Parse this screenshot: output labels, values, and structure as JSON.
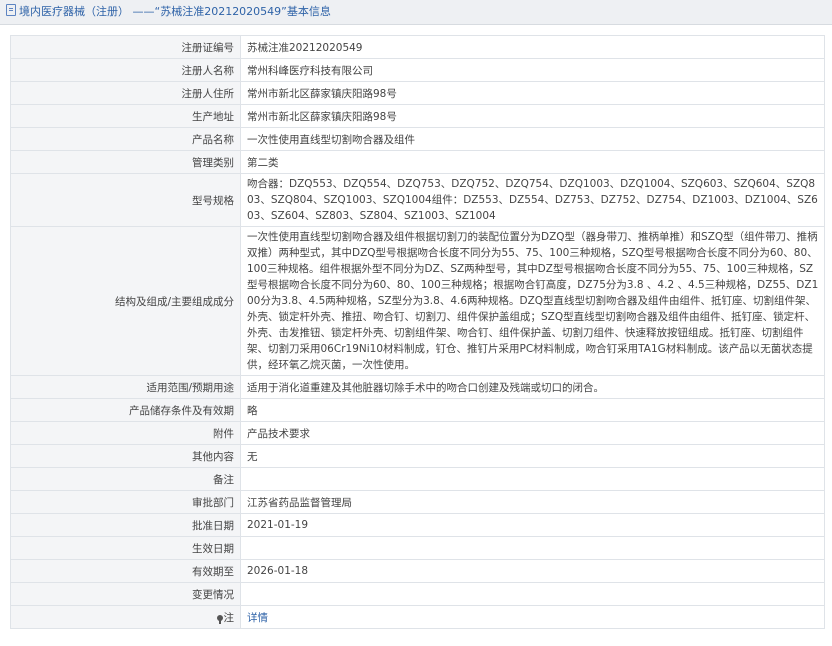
{
  "header": {
    "title": "境内医疗器械（注册） ——“苏械注准20212020549”基本信息"
  },
  "rows": [
    {
      "label": "注册证编号",
      "value": "苏械注准20212020549"
    },
    {
      "label": "注册人名称",
      "value": "常州科峰医疗科技有限公司"
    },
    {
      "label": "注册人住所",
      "value": "常州市新北区薛家镇庆阳路98号"
    },
    {
      "label": "生产地址",
      "value": "常州市新北区薛家镇庆阳路98号"
    },
    {
      "label": "产品名称",
      "value": "一次性使用直线型切割吻合器及组件"
    },
    {
      "label": "管理类别",
      "value": "第二类"
    },
    {
      "label": "型号规格",
      "value": "吻合器：DZQ553、DZQ554、DZQ753、DZQ752、DZQ754、DZQ1003、DZQ1004、SZQ603、SZQ604、SZQ803、SZQ804、SZQ1003、SZQ1004组件：DZ553、DZ554、DZ753、DZ752、DZ754、DZ1003、DZ1004、SZ603、SZ604、SZ803、SZ804、SZ1003、SZ1004"
    },
    {
      "label": "结构及组成/主要组成成分",
      "value": "一次性使用直线型切割吻合器及组件根据切割刀的装配位置分为DZQ型（器身带刀、推柄单推）和SZQ型（组件带刀、推柄双推）两种型式，其中DZQ型号根据吻合长度不同分为55、75、100三种规格，SZQ型号根据吻合长度不同分为60、80、100三种规格。组件根据外型不同分为DZ、SZ两种型号，其中DZ型号根据吻合长度不同分为55、75、100三种规格，SZ型号根据吻合长度不同分为60、80、100三种规格；根据吻合钉高度，DZ75分为3.8 、4.2 、4.5三种规格，DZ55、DZ100分为3.8、4.5两种规格，SZ型分为3.8、4.6两种规格。DZQ型直线型切割吻合器及组件由组件、抵钉座、切割组件架、外壳、锁定杆外壳、推扭、吻合钉、切割刀、组件保护盖组成；SZQ型直线型切割吻合器及组件由组件、抵钉座、锁定杆、外壳、击发推钮、锁定杆外壳、切割组件架、吻合钉、组件保护盖、切割刀组件、快速释放按钮组成。抵钉座、切割组件架、切割刀采用06Cr19Ni10材料制成，钉仓、推钉片采用PC材料制成，吻合钉采用TA1G材料制成。该产品以无菌状态提供，经环氧乙烷灭菌，一次性使用。"
    },
    {
      "label": "适用范围/预期用途",
      "value": "适用于消化道重建及其他脏器切除手术中的吻合口创建及残端或切口的闭合。"
    },
    {
      "label": "产品储存条件及有效期",
      "value": "略"
    },
    {
      "label": "附件",
      "value": "产品技术要求"
    },
    {
      "label": "其他内容",
      "value": "无"
    },
    {
      "label": "备注",
      "value": ""
    },
    {
      "label": "审批部门",
      "value": "江苏省药品监督管理局"
    },
    {
      "label": "批准日期",
      "value": "2021-01-19"
    },
    {
      "label": "生效日期",
      "value": ""
    },
    {
      "label": "有效期至",
      "value": "2026-01-18"
    },
    {
      "label": "变更情况",
      "value": ""
    }
  ],
  "footer": {
    "label": "注",
    "link": "详情",
    "icon": "note-icon"
  }
}
